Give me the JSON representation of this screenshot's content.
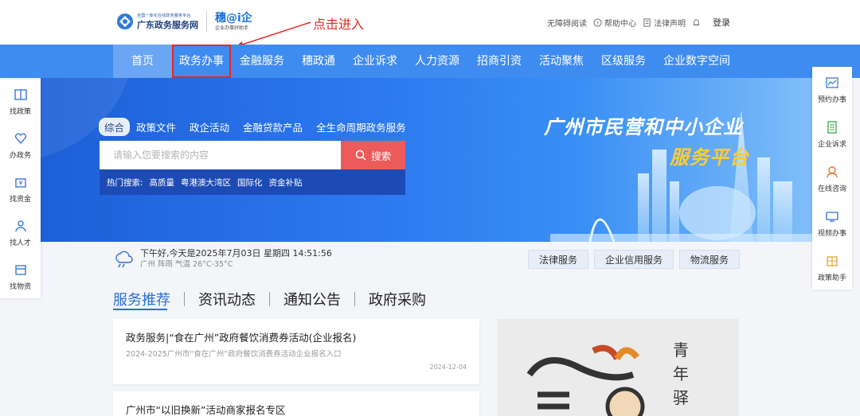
{
  "header": {
    "logo_small": "全国一体化在线政务服务平台",
    "logo_main": "广东政务服务网",
    "logo2_main": "穗@i企",
    "logo2_sub": "企业办事好助手",
    "annotation": "点击进入",
    "links": [
      "无障碍阅读",
      "帮助中心",
      "法律声明"
    ],
    "login": "登录"
  },
  "nav": {
    "items": [
      "首页",
      "政务办事",
      "金融服务",
      "穗政通",
      "企业诉求",
      "人力资源",
      "招商引资",
      "活动聚焦",
      "区级服务",
      "企业数字空间"
    ]
  },
  "banner": {
    "search_tabs": [
      "综合",
      "政策文件",
      "政企活动",
      "金融贷款产品",
      "全生命周期政务服务"
    ],
    "search_placeholder": "请输入您要搜索的内容",
    "search_button": "搜索",
    "hot_label": "热门搜索:",
    "hot_keywords": [
      "高质量",
      "粤港澳大湾区",
      "国际化",
      "资金补贴"
    ],
    "title": "广州市民营和中小企业",
    "subtitle": "服务平台"
  },
  "side_left": [
    "找政策",
    "办政务",
    "找资金",
    "找人才",
    "找物资"
  ],
  "side_right": [
    "预约办事",
    "企业诉求",
    "在线咨询",
    "视频办事",
    "政策助手"
  ],
  "weather": {
    "line1": "下午好,今天是2025年7月03日 星期四 14:51:56",
    "line2": "广州 阵雨 气温 26°C-35°C"
  },
  "service_buttons": [
    "法律服务",
    "企业信用服务",
    "物流服务"
  ],
  "content_tabs": [
    "服务推荐",
    "资讯动态",
    "通知公告",
    "政府采购"
  ],
  "cards": [
    {
      "title": "政务服务|“食在广州”政府餐饮消费券活动(企业报名)",
      "desc": "2024-2025广州市“食在广州”政府餐饮消费券活动企业报名入口",
      "date": "2024-12-04"
    },
    {
      "title": "广州市“以旧换新”活动商家报名专区"
    }
  ],
  "promo": {
    "word": "青年驿"
  },
  "colors": {
    "nav": "#3f8cf1",
    "accent": "#2c6fd6",
    "search_btn": "#ec5a5a",
    "annotation": "#e8261f"
  }
}
